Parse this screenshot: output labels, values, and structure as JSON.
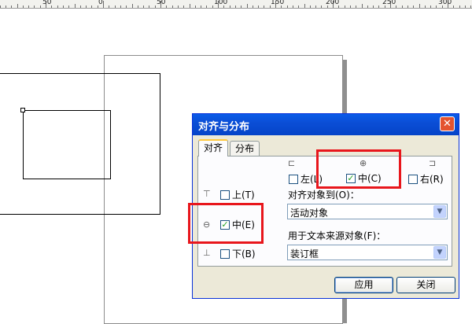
{
  "ruler": {
    "labels": [
      "50",
      "0",
      "50",
      "100",
      "150",
      "200",
      "250",
      "300"
    ]
  },
  "dialog": {
    "title": "对齐与分布",
    "close_glyph": "✕",
    "tabs": [
      {
        "label": "对齐"
      },
      {
        "label": "分布"
      }
    ],
    "horizontal": {
      "left_label": "左(L)",
      "center_label": "中(C)",
      "right_label": "右(R)",
      "left_checked": false,
      "center_checked": true,
      "right_checked": false
    },
    "vertical": {
      "top_label": "上(T)",
      "center_label": "中(E)",
      "bottom_label": "下(B)",
      "top_checked": false,
      "center_checked": true,
      "bottom_checked": false
    },
    "align_to": {
      "label": "对齐对象到(O)：",
      "value": "活动对象"
    },
    "text_source": {
      "label": "用于文本来源对象(F)：",
      "value": "装订框"
    },
    "buttons": {
      "apply": "应用",
      "close": "关闭"
    },
    "check_glyph": "✓",
    "highlight_color": "#e8161c"
  }
}
